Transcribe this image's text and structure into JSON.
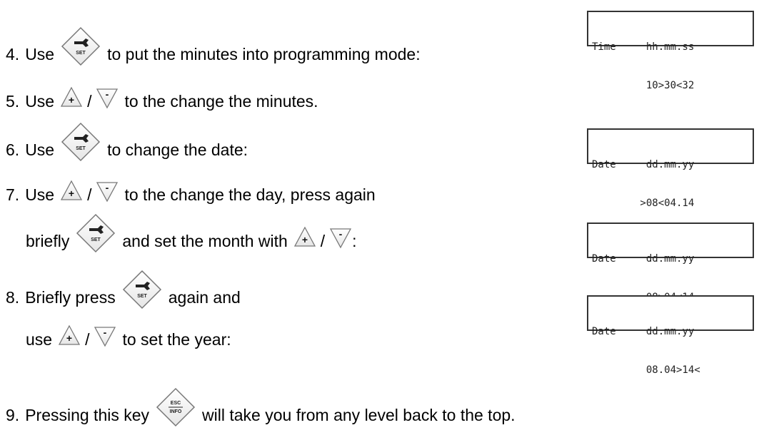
{
  "steps": {
    "s4": {
      "num": "4.",
      "pre": "Use",
      "post": "to put the minutes into programming mode:"
    },
    "s5": {
      "num": "5.",
      "pre": "Use",
      "slash": "/",
      "post": "to the change the minutes."
    },
    "s6": {
      "num": "6.",
      "pre": "Use",
      "post": "to change the date:"
    },
    "s7a": {
      "num": "7.",
      "pre": "Use",
      "slash": "/",
      "post": "to the change the day, press again"
    },
    "s7b": {
      "pre": "briefly",
      "mid": "and set the month with",
      "slash": "/",
      "post": ":"
    },
    "s8a": {
      "num": "8.",
      "pre": "Briefly press",
      "post": "again and"
    },
    "s8b": {
      "pre": "use",
      "slash": "/",
      "post": "to set the year:"
    },
    "s9": {
      "num": "9.",
      "pre": "Pressing this key",
      "post": "will take you from any level back to the top."
    }
  },
  "keys": {
    "set": "SET",
    "plus": "+",
    "minus": "-",
    "esc": "ESC",
    "info": "INFO"
  },
  "displays": [
    {
      "line1": "Time     hh.mm.ss",
      "line2": "         10>30<32"
    },
    {
      "line1": "Date     dd.mm.yy",
      "line2": "        >08<04.14"
    },
    {
      "line1": "Date     dd.mm.yy",
      "line2": "         08>04<14"
    },
    {
      "line1": "Date     dd.mm.yy",
      "line2": "         08.04>14<"
    }
  ]
}
